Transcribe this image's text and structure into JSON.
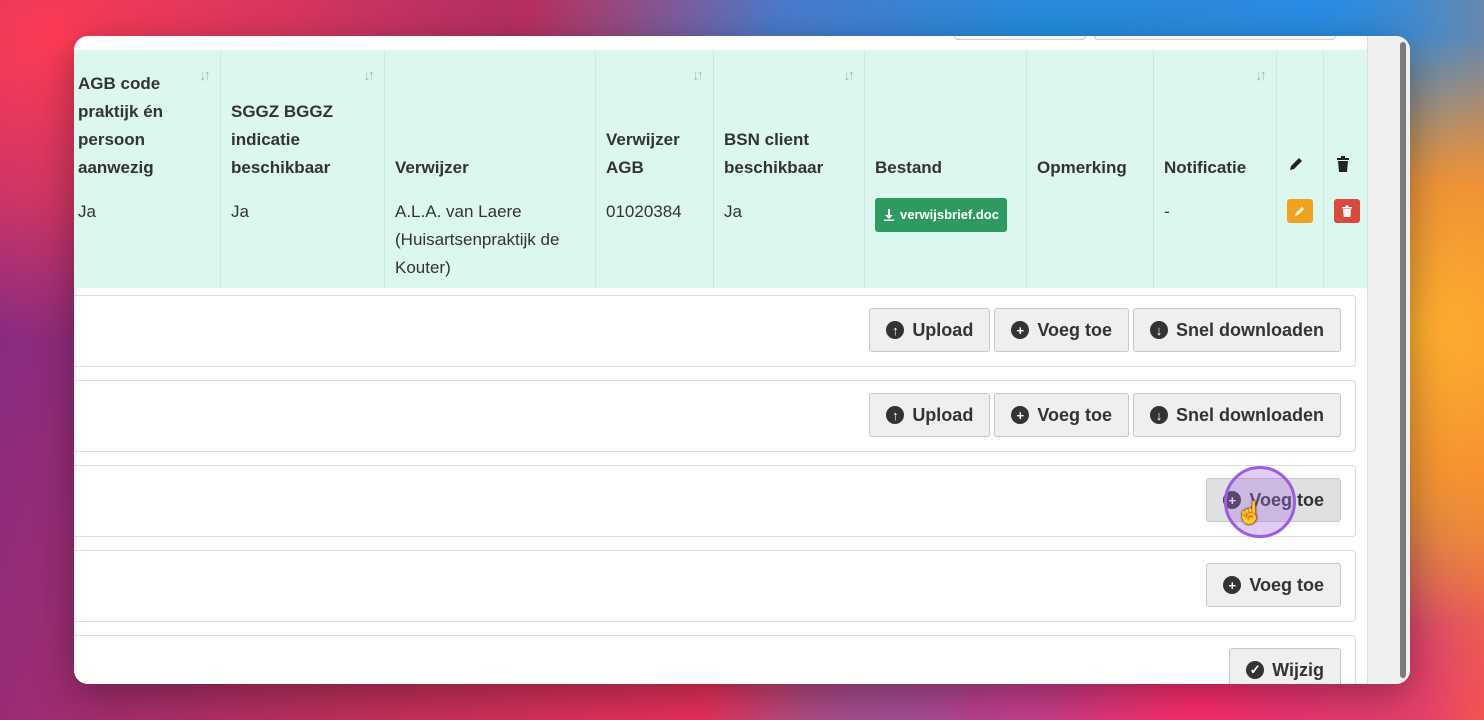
{
  "table": {
    "headers": [
      "AGB code praktijk én persoon aanwezig",
      "SGGZ BGGZ indicatie beschikbaar",
      "Verwijzer",
      "Verwijzer AGB",
      "BSN client beschikbaar",
      "Bestand",
      "Opmerking",
      "Notificatie",
      "",
      ""
    ],
    "row": {
      "agb_code": "Ja",
      "sggz": "Ja",
      "verwijzer": "A.L.A. van Laere (Huisartsenpraktijk de Kouter)",
      "verwijzer_agb": "01020384",
      "bsn": "Ja",
      "bestand": "verwijsbrief.doc",
      "opmerking": "",
      "notificatie": "-"
    }
  },
  "panels": [
    {
      "buttons": [
        "Upload",
        "Voeg toe",
        "Snel downloaden"
      ]
    },
    {
      "buttons": [
        "Upload",
        "Voeg toe",
        "Snel downloaden"
      ]
    },
    {
      "buttons": [
        "Voeg toe"
      ]
    },
    {
      "buttons": [
        "Voeg toe"
      ]
    },
    {
      "buttons": [
        "Wijzig"
      ]
    }
  ],
  "icons": {
    "upload": "arrow-up-circle-icon",
    "add": "plus-circle-icon",
    "download": "arrow-down-circle-icon",
    "edit": "pencil-icon",
    "delete": "trash-icon",
    "confirm": "check-circle-icon"
  },
  "colors": {
    "row_bg": "#dcf8ee",
    "file_button": "#2e9a61",
    "edit_button": "#f0a21c",
    "delete_button": "#d94a3c"
  }
}
